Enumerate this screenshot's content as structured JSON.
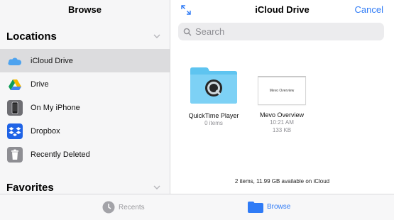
{
  "sidebar": {
    "title": "Browse",
    "locations_header": "Locations",
    "favorites_header": "Favorites",
    "items": [
      {
        "label": "iCloud Drive",
        "icon": "icloud-icon",
        "selected": true
      },
      {
        "label": "Drive",
        "icon": "google-drive-icon",
        "selected": false
      },
      {
        "label": "On My iPhone",
        "icon": "iphone-icon",
        "selected": false
      },
      {
        "label": "Dropbox",
        "icon": "dropbox-icon",
        "selected": false
      },
      {
        "label": "Recently Deleted",
        "icon": "trash-icon",
        "selected": false
      }
    ]
  },
  "main": {
    "title": "iCloud Drive",
    "cancel_label": "Cancel",
    "search_placeholder": "Search",
    "files": [
      {
        "name": "QuickTime Player",
        "meta1": "0 items",
        "icon": "folder-quicktime-icon"
      },
      {
        "name": "Mevo Overview",
        "meta1": "10:21 AM",
        "meta2": "133 KB",
        "thumb_text": "Mevo Overview",
        "icon": "document-thumbnail"
      }
    ],
    "footer": "2 items, 11.99 GB available on iCloud"
  },
  "tabbar": {
    "recents_label": "Recents",
    "browse_label": "Browse"
  },
  "colors": {
    "accent": "#2f7bf6",
    "folder": "#5ec4f0"
  }
}
